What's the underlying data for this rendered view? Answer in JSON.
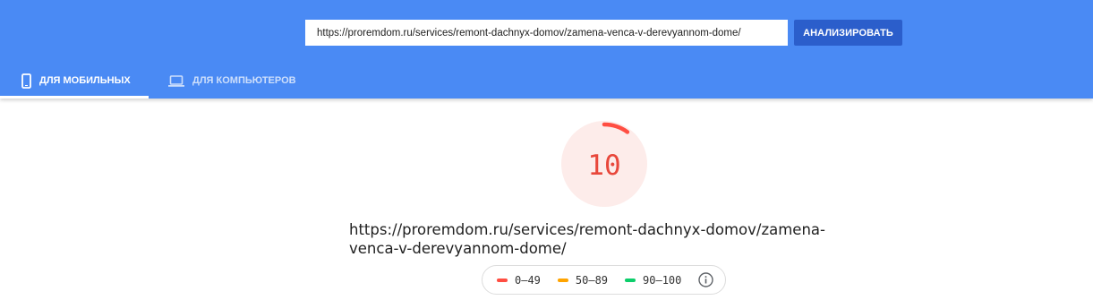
{
  "search": {
    "url_value": "https://proremdom.ru/services/remont-dachnyx-domov/zamena-venca-v-derevyannom-dome/",
    "analyze_label": "АНАЛИЗИРОВАТЬ"
  },
  "tabs": [
    {
      "label": "ДЛЯ МОБИЛЬНЫХ",
      "icon": "smartphone-icon",
      "active": true
    },
    {
      "label": "ДЛЯ КОМПЬЮТЕРОВ",
      "icon": "laptop-icon",
      "active": false
    }
  ],
  "result": {
    "score": "10",
    "score_fraction": 0.1,
    "url_line1": "https://proremdom.ru/services/remont-dachnyx-domov/zamena-",
    "url_line2": "venca-v-derevyannom-dome/"
  },
  "legend": {
    "items": [
      {
        "range": "0–49",
        "color": "#ff4e42"
      },
      {
        "range": "50–89",
        "color": "#ffa400"
      },
      {
        "range": "90–100",
        "color": "#0cce6b"
      }
    ],
    "info_icon": "info-icon"
  },
  "colors": {
    "header_bg": "#4a8af4",
    "button_bg": "#2b5ecb",
    "score_fail": "#ff4e42",
    "score_fail_bg": "#fdecea"
  }
}
